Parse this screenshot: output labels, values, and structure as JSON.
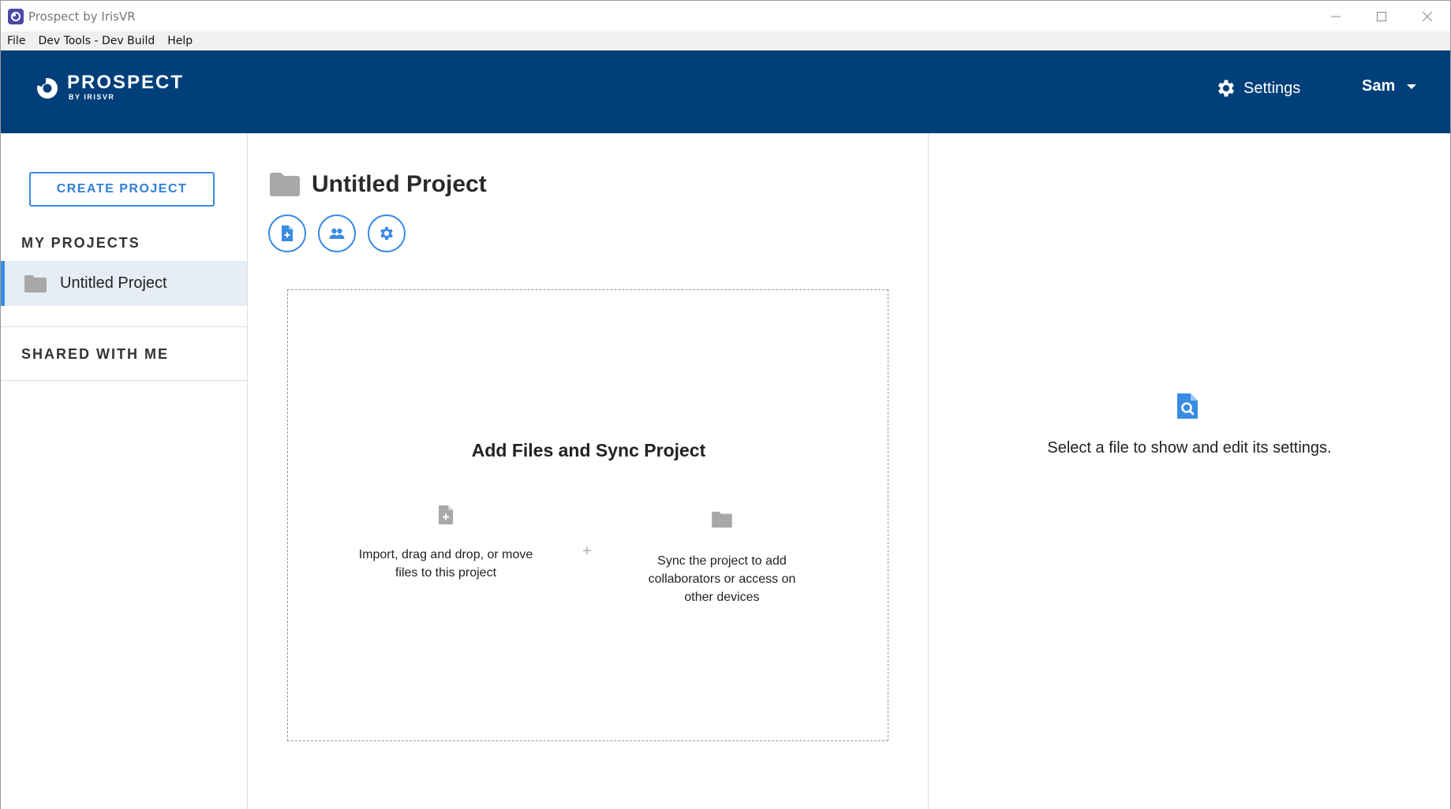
{
  "window": {
    "title": "Prospect by IrisVR",
    "controls": [
      "minimize-icon",
      "maximize-icon",
      "close-icon"
    ]
  },
  "menu": {
    "items": [
      "File",
      "Dev Tools - Dev Build",
      "Help"
    ]
  },
  "header": {
    "logo_title": "PROSPECT",
    "logo_subtitle": "BY IRISVR",
    "settings_label": "Settings",
    "user_name": "Sam"
  },
  "sidebar": {
    "create_button": "CREATE PROJECT",
    "my_projects_label": "MY PROJECTS",
    "projects": [
      {
        "name": "Untitled Project",
        "selected": true
      }
    ],
    "shared_label": "SHARED WITH ME"
  },
  "main": {
    "project_title": "Untitled Project",
    "actions": [
      "add-file-icon",
      "collaborators-icon",
      "gear-icon"
    ],
    "dropzone": {
      "title": "Add Files and Sync Project",
      "import_line1": "Import, drag and drop, or move",
      "import_line2": "files to this project",
      "plus": "+",
      "sync_line1": "Sync the project to add",
      "sync_line2": "collaborators or access on",
      "sync_line3": "other devices"
    }
  },
  "right_panel": {
    "empty_message": "Select a file to show and edit its settings."
  },
  "colors": {
    "header_bg": "#003f7a",
    "accent": "#3a8be3",
    "selected_bg": "#e6edf4",
    "icon_gray": "#a8a8a8"
  }
}
